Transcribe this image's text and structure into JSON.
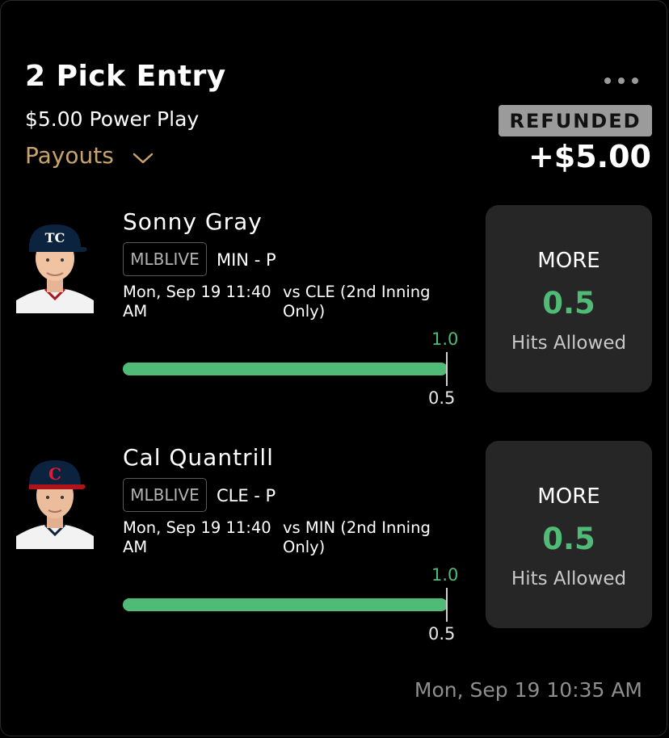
{
  "entry": {
    "title": "2 Pick Entry",
    "subtitle": "$5.00 Power Play",
    "payouts_label": "Payouts",
    "status": "REFUNDED",
    "amount": "+$5.00",
    "timestamp": "Mon, Sep 19 10:35 AM"
  },
  "picks": [
    {
      "player": "Sonny Gray",
      "league": "MLBLIVE",
      "team_position": "MIN - P",
      "game_time": "Mon, Sep 19 11:40 AM",
      "opponent": "vs CLE (2nd Inning Only)",
      "actual": "1.0",
      "line": "0.5",
      "progress_fraction": 1.0,
      "direction": "MORE",
      "line_value": "0.5",
      "stat": "Hits Allowed",
      "cap_letter_icon": "twins-cap-icon"
    },
    {
      "player": "Cal Quantrill",
      "league": "MLBLIVE",
      "team_position": "CLE - P",
      "game_time": "Mon, Sep 19 11:40 AM",
      "opponent": "vs MIN (2nd Inning Only)",
      "actual": "1.0",
      "line": "0.5",
      "progress_fraction": 1.0,
      "direction": "MORE",
      "line_value": "0.5",
      "stat": "Hits Allowed",
      "cap_letter_icon": "guardians-cap-icon"
    }
  ],
  "colors": {
    "accent_gold": "#c9a36c",
    "progress_green": "#4fbb76",
    "badge_gray": "#9b9b9b",
    "card_bg": "#262626"
  }
}
